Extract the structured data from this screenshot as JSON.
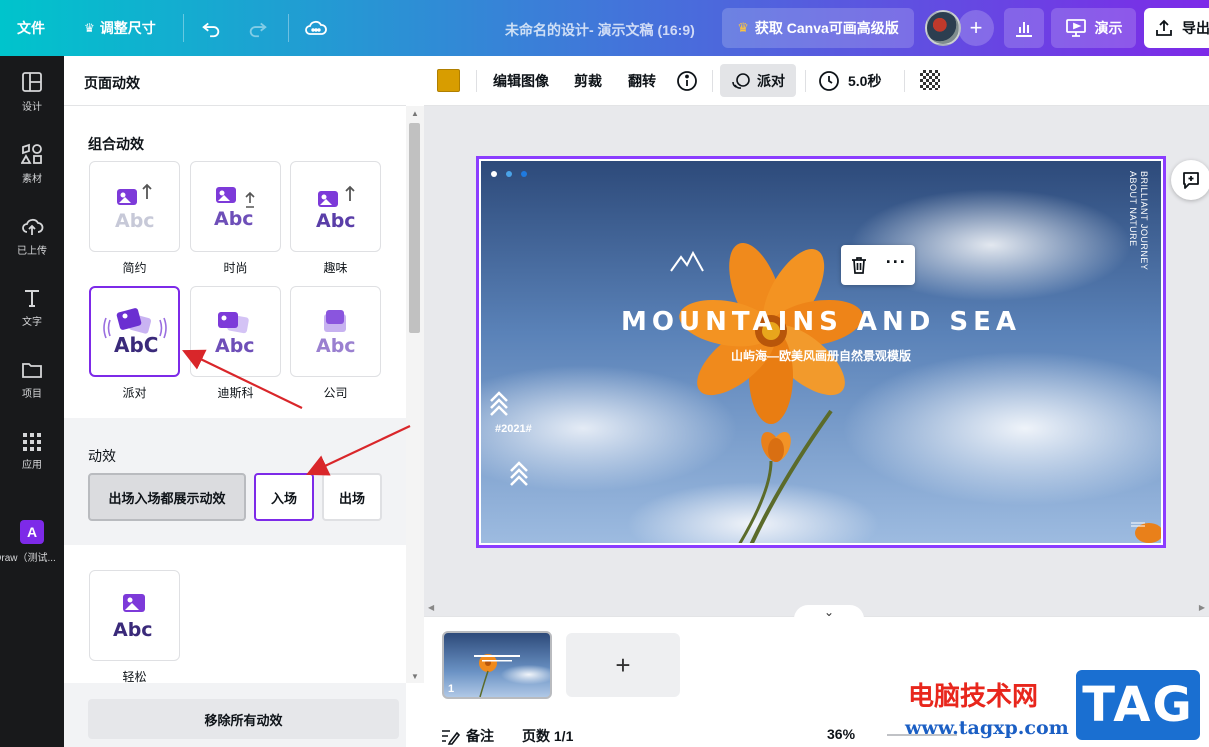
{
  "topbar": {
    "file": "文件",
    "resize": "调整尺寸",
    "doc_title": "未命名的设计- 演示文稿 (16:9)",
    "upgrade": "获取 Canva可画高级版",
    "present": "演示",
    "export": "导出"
  },
  "rail": {
    "items": [
      {
        "label": "设计",
        "icon": "layout-icon"
      },
      {
        "label": "素材",
        "icon": "shapes-icon"
      },
      {
        "label": "已上传",
        "icon": "cloud-upload-icon"
      },
      {
        "label": "文字",
        "icon": "text-icon"
      },
      {
        "label": "项目",
        "icon": "folder-icon"
      },
      {
        "label": "应用",
        "icon": "apps-grid-icon"
      },
      {
        "label": "Draw（测试...",
        "icon": "draw-app-icon"
      }
    ]
  },
  "panel": {
    "title": "页面动效",
    "combo_title": "组合动效",
    "tiles": [
      {
        "label": "简约",
        "text": "Abc"
      },
      {
        "label": "时尚",
        "text": "Abc"
      },
      {
        "label": "趣味",
        "text": "Abc"
      },
      {
        "label": "派对",
        "text": "AbC",
        "selected": true
      },
      {
        "label": "迪斯科",
        "text": "Abc"
      },
      {
        "label": "公司",
        "text": "Abc"
      }
    ],
    "motion_title": "动效",
    "modes": [
      "出场入场都展示动效",
      "入场",
      "出场"
    ],
    "selected_mode": "入场",
    "extra_tile": {
      "label": "轻松",
      "text": "Abc"
    },
    "remove_all": "移除所有动效"
  },
  "toolbar": {
    "color_swatch": "#d89d00",
    "edit_image": "编辑图像",
    "crop": "剪裁",
    "flip": "翻转",
    "animation": "派对",
    "duration": "5.0秒"
  },
  "slide": {
    "title": "MOUNTAINS AND SEA",
    "subtitle": "山屿海—欧美风画册自然景观模版",
    "vertical_line1": "BRILLIANT JOURNEY",
    "vertical_line2": "ABOUT NATURE",
    "year": "#2021#"
  },
  "strip": {
    "page_number": "1",
    "add_page": "+"
  },
  "status": {
    "notes": "备注",
    "pages": "页数 1/1",
    "zoom": "36%"
  },
  "watermark": {
    "site_name": "电脑技术网",
    "url": "www.tagxp.com",
    "logo": "TAG"
  },
  "colors": {
    "accent": "#7d2ae8",
    "rail_bg": "#18191b",
    "annotation_arrow": "#d9262a"
  }
}
